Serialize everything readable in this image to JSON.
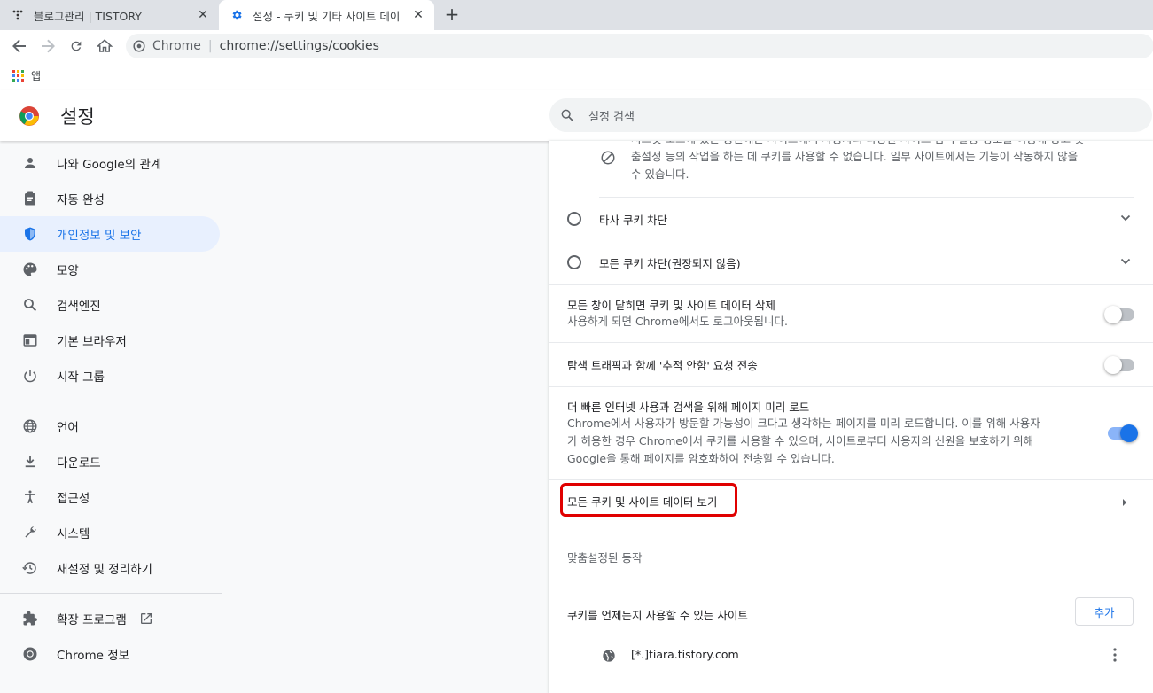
{
  "browser": {
    "tabs": [
      {
        "title": "블로그관리 | TISTORY",
        "active": false
      },
      {
        "title": "설정 - 쿠키 및 기타 사이트 데이",
        "active": true
      }
    ],
    "omnibox": {
      "origin": "Chrome",
      "url": "chrome://settings/cookies"
    },
    "bookmarks": {
      "apps_label": "앱"
    }
  },
  "header": {
    "title": "설정",
    "search_placeholder": "설정 검색"
  },
  "sidebar": {
    "items": [
      {
        "label": "나와 Google의 관계",
        "icon": "person-icon"
      },
      {
        "label": "자동 완성",
        "icon": "clipboard-icon"
      },
      {
        "label": "개인정보 및 보안",
        "icon": "shield-icon",
        "selected": true
      },
      {
        "label": "모양",
        "icon": "palette-icon"
      },
      {
        "label": "검색엔진",
        "icon": "search-icon"
      },
      {
        "label": "기본 브라우저",
        "icon": "browser-icon"
      },
      {
        "label": "시작 그룹",
        "icon": "power-icon"
      }
    ],
    "advanced": [
      {
        "label": "언어",
        "icon": "globe-icon"
      },
      {
        "label": "다운로드",
        "icon": "download-icon"
      },
      {
        "label": "접근성",
        "icon": "accessibility-icon"
      },
      {
        "label": "시스템",
        "icon": "wrench-icon"
      },
      {
        "label": "재설정 및 정리하기",
        "icon": "history-icon"
      }
    ],
    "footer": [
      {
        "label": "확장 프로그램",
        "icon": "puzzle-icon"
      },
      {
        "label": "Chrome 정보",
        "icon": "chrome-icon"
      }
    ]
  },
  "content": {
    "block_desc_line1": "시크릿 모드에 있는 동안에는 사이트에서 사용자의 다양한 사이트 탐색 활동 정보를 이용해 광고 맞",
    "block_desc_line2": "춤설정 등의 작업을 하는 데 쿠키를 사용할 수 없습니다. 일부 사이트에서는 기능이 작동하지 않을",
    "block_desc_line3": "수 있습니다.",
    "radio_third_party": "타사 쿠키 차단",
    "radio_all": "모든 쿠키 차단(권장되지 않음)",
    "clear_on_exit_title": "모든 창이 닫히면 쿠키 및 사이트 데이터 삭제",
    "clear_on_exit_sub": "사용하게 되면 Chrome에서도 로그아웃됩니다.",
    "clear_on_exit_on": false,
    "dnt_title": "탐색 트래픽과 함께 '추적 안함' 요청 전송",
    "dnt_on": false,
    "preload_title": "더 빠른 인터넷 사용과 검색을 위해 페이지 미리 로드",
    "preload_line1": "Chrome에서 사용자가 방문할 가능성이 크다고 생각하는 페이지를 미리 로드합니다. 이를 위해 사용자",
    "preload_line2": "가 허용한 경우 Chrome에서 쿠키를 사용할 수 있으며, 사이트로부터 사용자의 신원을 보호하기 위해",
    "preload_line3": "Google을 통해 페이지를 암호화하여 전송할 수 있습니다.",
    "preload_on": true,
    "see_all_cookies": "모든 쿠키 및 사이트 데이터 보기",
    "custom_behaviors": "맞춤설정된 동작",
    "allow_sites_label": "쿠키를 언제든지 사용할 수 있는 사이트",
    "add_button": "추가",
    "site_entry": "[*.]tiara.tistory.com"
  },
  "colors": {
    "accent": "#1a73e8",
    "highlight": "#e00000",
    "selected_bg": "#e8f0fe"
  }
}
